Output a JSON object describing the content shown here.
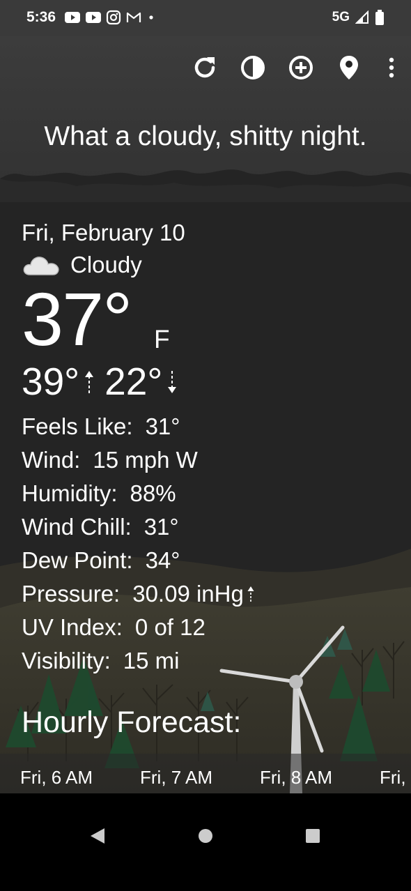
{
  "status_bar": {
    "time": "5:36",
    "network": "5G"
  },
  "toolbar": {
    "refresh": "refresh-icon",
    "theme": "theme-icon",
    "add": "add-location-icon",
    "location": "location-pin-icon",
    "more": "more-vert-icon"
  },
  "tagline": "What a cloudy, shitty night.",
  "current": {
    "date": "Fri, February 10",
    "condition": "Cloudy",
    "temperature": "37°",
    "unit": "F",
    "high": "39°",
    "low": "22°"
  },
  "details": [
    {
      "label": "Feels Like:",
      "value": "31°"
    },
    {
      "label": "Wind:",
      "value": "15 mph W"
    },
    {
      "label": "Humidity:",
      "value": "88%"
    },
    {
      "label": "Wind Chill:",
      "value": "31°"
    },
    {
      "label": "Dew Point:",
      "value": "34°"
    },
    {
      "label": "Pressure:",
      "value": "30.09 inHg"
    },
    {
      "label": "UV Index:",
      "value": "0 of 12"
    },
    {
      "label": "Visibility:",
      "value": "15 mi"
    }
  ],
  "hourly": {
    "title": "Hourly Forecast:",
    "items": [
      "Fri, 6 AM",
      "Fri, 7 AM",
      "Fri, 8 AM",
      "Fri,"
    ]
  },
  "colors": {
    "background": "#242424",
    "sky_top": "#3a3a3a",
    "hill": "#4a4735",
    "tree": "#1f4a2e",
    "text": "#ffffff"
  }
}
